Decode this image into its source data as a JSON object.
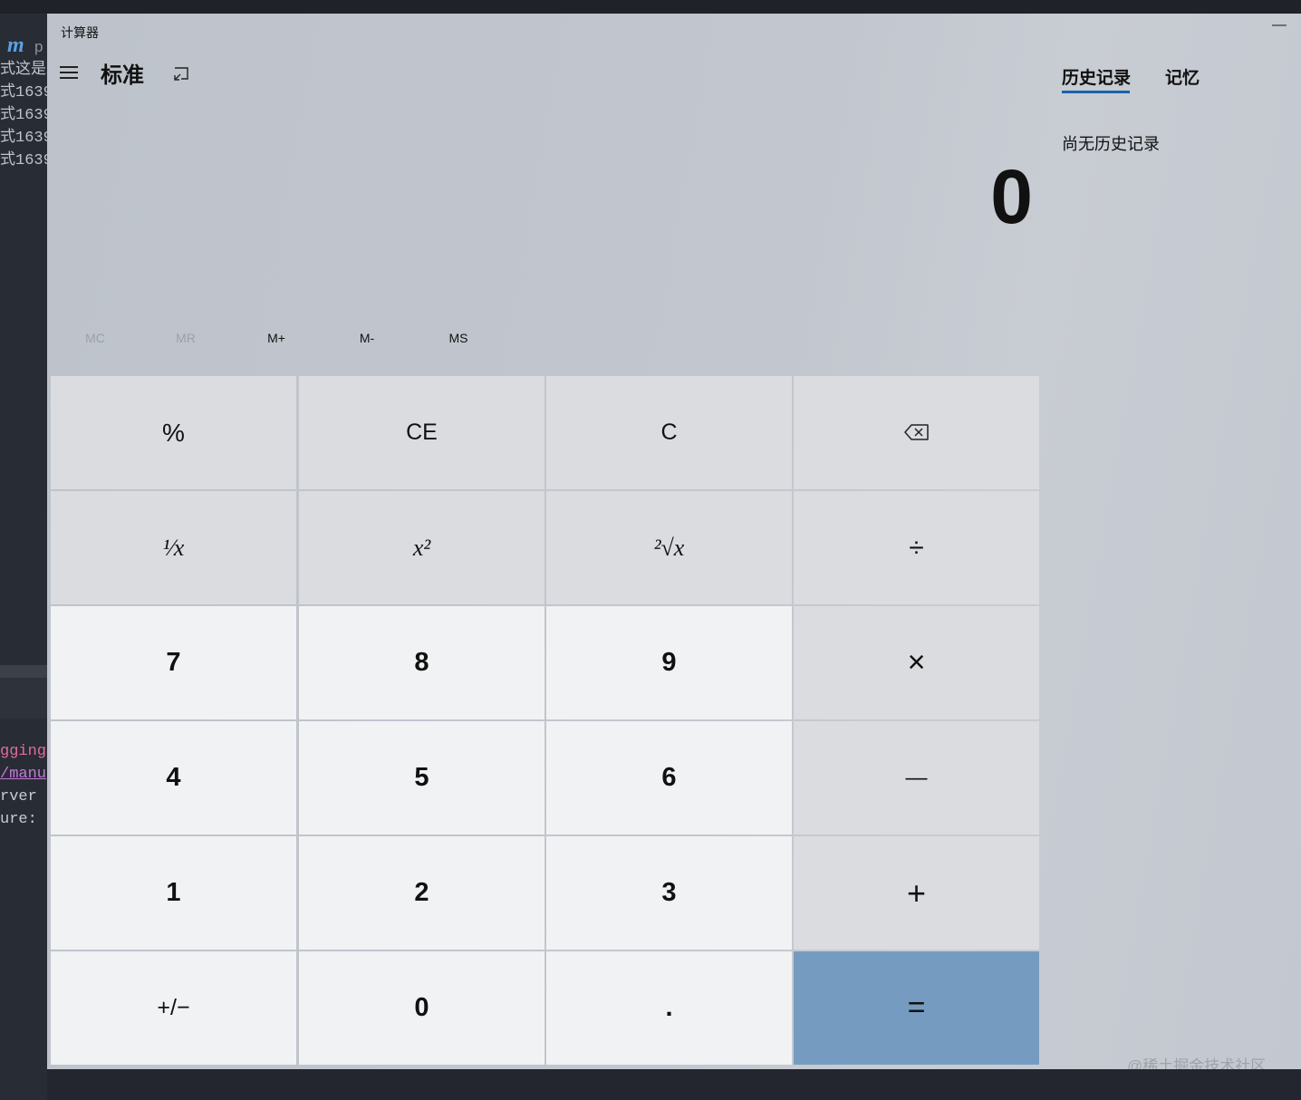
{
  "window": {
    "title": "计算器",
    "minimize_glyph": "—",
    "mode_title": "标准"
  },
  "display": {
    "value": "0"
  },
  "memory": {
    "buttons": [
      {
        "label": "MC",
        "enabled": false
      },
      {
        "label": "MR",
        "enabled": false
      },
      {
        "label": "M+",
        "enabled": true
      },
      {
        "label": "M-",
        "enabled": true
      },
      {
        "label": "MS",
        "enabled": true
      }
    ]
  },
  "keys": {
    "percent": "%",
    "ce": "CE",
    "c": "C",
    "backspace_icon": "backspace-icon",
    "reciprocal": "¹⁄x",
    "square": "x²",
    "sqrt": "²√x",
    "divide": "÷",
    "seven": "7",
    "eight": "8",
    "nine": "9",
    "multiply": "×",
    "four": "4",
    "five": "5",
    "six": "6",
    "minus": "—",
    "one": "1",
    "two": "2",
    "three": "3",
    "plus": "+",
    "negate": "+/−",
    "zero": "0",
    "decimal": ".",
    "equals": "="
  },
  "sidebar": {
    "tabs": [
      {
        "label": "历史记录",
        "active": true
      },
      {
        "label": "记忆",
        "active": false
      }
    ],
    "history_empty": "尚无历史记录"
  },
  "background": {
    "logo": "m",
    "logo_suffix": "p",
    "lines_top": [
      "式这是来",
      "式1639",
      "式1639",
      "式1639",
      "式1639"
    ],
    "lines_bottom": [
      "gging",
      "/manu",
      "rver",
      "ure:"
    ]
  },
  "watermark": "@稀土掘金技术社区",
  "colors": {
    "accent": "#1a63a8",
    "equals_key": "#759cc0",
    "number_key": "#f1f2f4",
    "operator_key": "#dadcdf"
  }
}
